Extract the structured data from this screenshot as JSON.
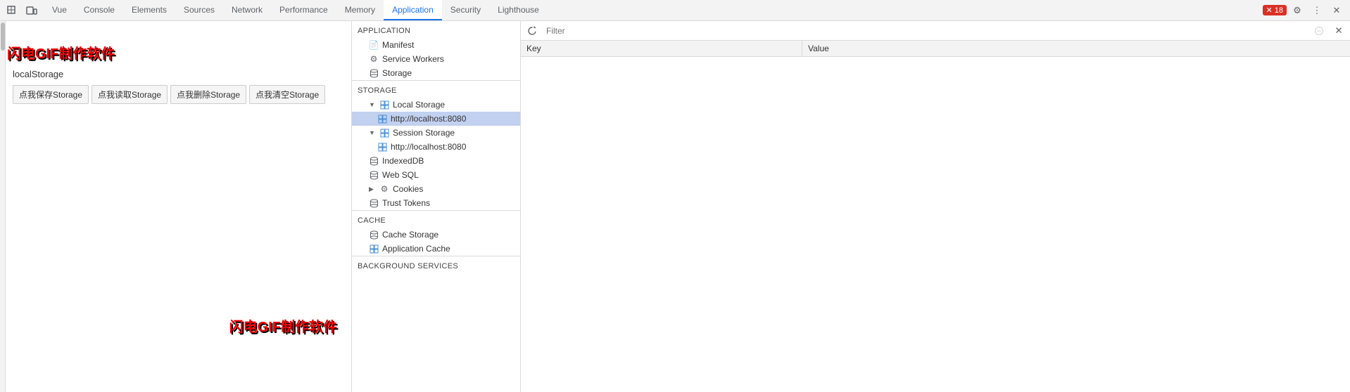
{
  "devtools": {
    "tabs": [
      {
        "label": "Vue",
        "active": false
      },
      {
        "label": "Console",
        "active": false
      },
      {
        "label": "Elements",
        "active": false
      },
      {
        "label": "Sources",
        "active": false
      },
      {
        "label": "Network",
        "active": false
      },
      {
        "label": "Performance",
        "active": false
      },
      {
        "label": "Memory",
        "active": false
      },
      {
        "label": "Application",
        "active": true
      },
      {
        "label": "Security",
        "active": false
      },
      {
        "label": "Lighthouse",
        "active": false
      }
    ],
    "error_count": "18",
    "toolbar": {
      "filter_placeholder": "Filter"
    }
  },
  "page": {
    "subtitle": "localStorage",
    "buttons": [
      "点我保存Storage",
      "点我读取Storage",
      "点我删除Storage",
      "点我清空Storage"
    ],
    "watermark": "闪电GIF制作软件",
    "watermark2": "闪电GIF制作软件"
  },
  "sidebar": {
    "sections": [
      {
        "title": "Application",
        "items": [
          {
            "label": "Manifest",
            "icon": "doc",
            "indent": 1
          },
          {
            "label": "Service Workers",
            "icon": "gear",
            "indent": 1
          },
          {
            "label": "Storage",
            "icon": "cylinder",
            "indent": 1
          }
        ]
      },
      {
        "title": "Storage",
        "items": [
          {
            "label": "Local Storage",
            "icon": "grid",
            "indent": 1,
            "expanded": true
          },
          {
            "label": "http://localhost:8080",
            "icon": "grid",
            "indent": 2,
            "selected": true
          },
          {
            "label": "Session Storage",
            "icon": "grid",
            "indent": 1,
            "expanded": true
          },
          {
            "label": "http://localhost:8080",
            "icon": "grid",
            "indent": 2
          },
          {
            "label": "IndexedDB",
            "icon": "cylinder",
            "indent": 1
          },
          {
            "label": "Web SQL",
            "icon": "cylinder",
            "indent": 1
          },
          {
            "label": "Cookies",
            "icon": "cookie",
            "indent": 1,
            "expandable": true
          },
          {
            "label": "Trust Tokens",
            "icon": "token",
            "indent": 1
          }
        ]
      },
      {
        "title": "Cache",
        "items": [
          {
            "label": "Cache Storage",
            "icon": "cylinder",
            "indent": 1
          },
          {
            "label": "Application Cache",
            "icon": "grid",
            "indent": 1
          }
        ]
      },
      {
        "title": "Background Services",
        "items": []
      }
    ]
  },
  "table": {
    "columns": [
      {
        "label": "Key"
      },
      {
        "label": "Value"
      }
    ],
    "rows": []
  }
}
